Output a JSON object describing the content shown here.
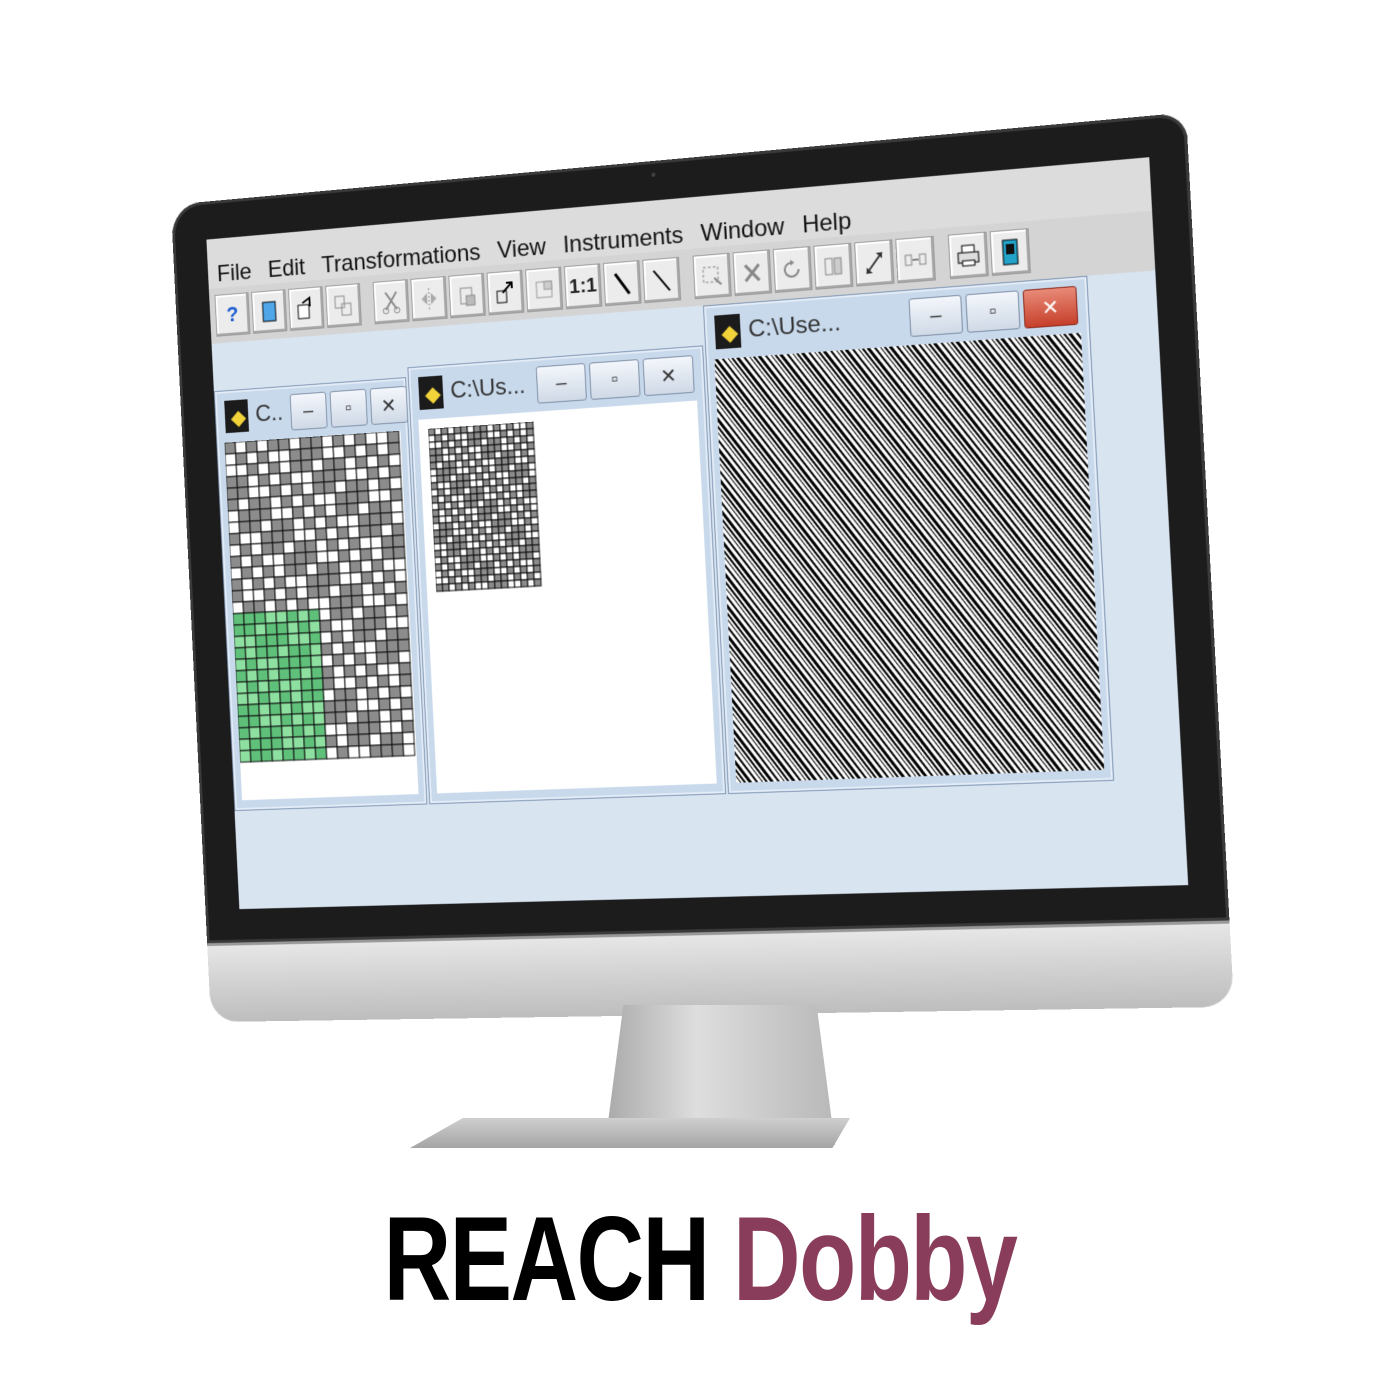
{
  "menu": [
    "File",
    "Edit",
    "Transformations",
    "View",
    "Instruments",
    "Window",
    "Help"
  ],
  "toolbar": {
    "icons": [
      "help-icon",
      "new-document-icon",
      "open-icon",
      "save-icon",
      "cut-icon",
      "mirror-icon",
      "paste-icon",
      "export-icon",
      "zoom-out-icon",
      "actual-size-icon",
      "pencil-icon",
      "line-icon",
      "selection-icon",
      "delete-icon",
      "rotate-icon",
      "flip-icon",
      "resize-icon",
      "insert-icon",
      "print-icon",
      "machine-icon"
    ],
    "help_glyph": "?",
    "actual_size_glyph": "1:1"
  },
  "windows": [
    {
      "title": "C..",
      "minimize": "–",
      "maximize": "▫",
      "close": "✕"
    },
    {
      "title": "C:\\Us...",
      "minimize": "–",
      "maximize": "▫",
      "close": "✕"
    },
    {
      "title": "C:\\Use...",
      "minimize": "–",
      "maximize": "▫",
      "close": "✕"
    }
  ],
  "colors": {
    "lift_cell": "#8c8c8c",
    "highlight_cell": "#8ee0a0",
    "grid_line": "#111111",
    "accent_word": "#8a3d5a"
  },
  "brand": {
    "word1": "REACH",
    "word2": "Dobby"
  }
}
